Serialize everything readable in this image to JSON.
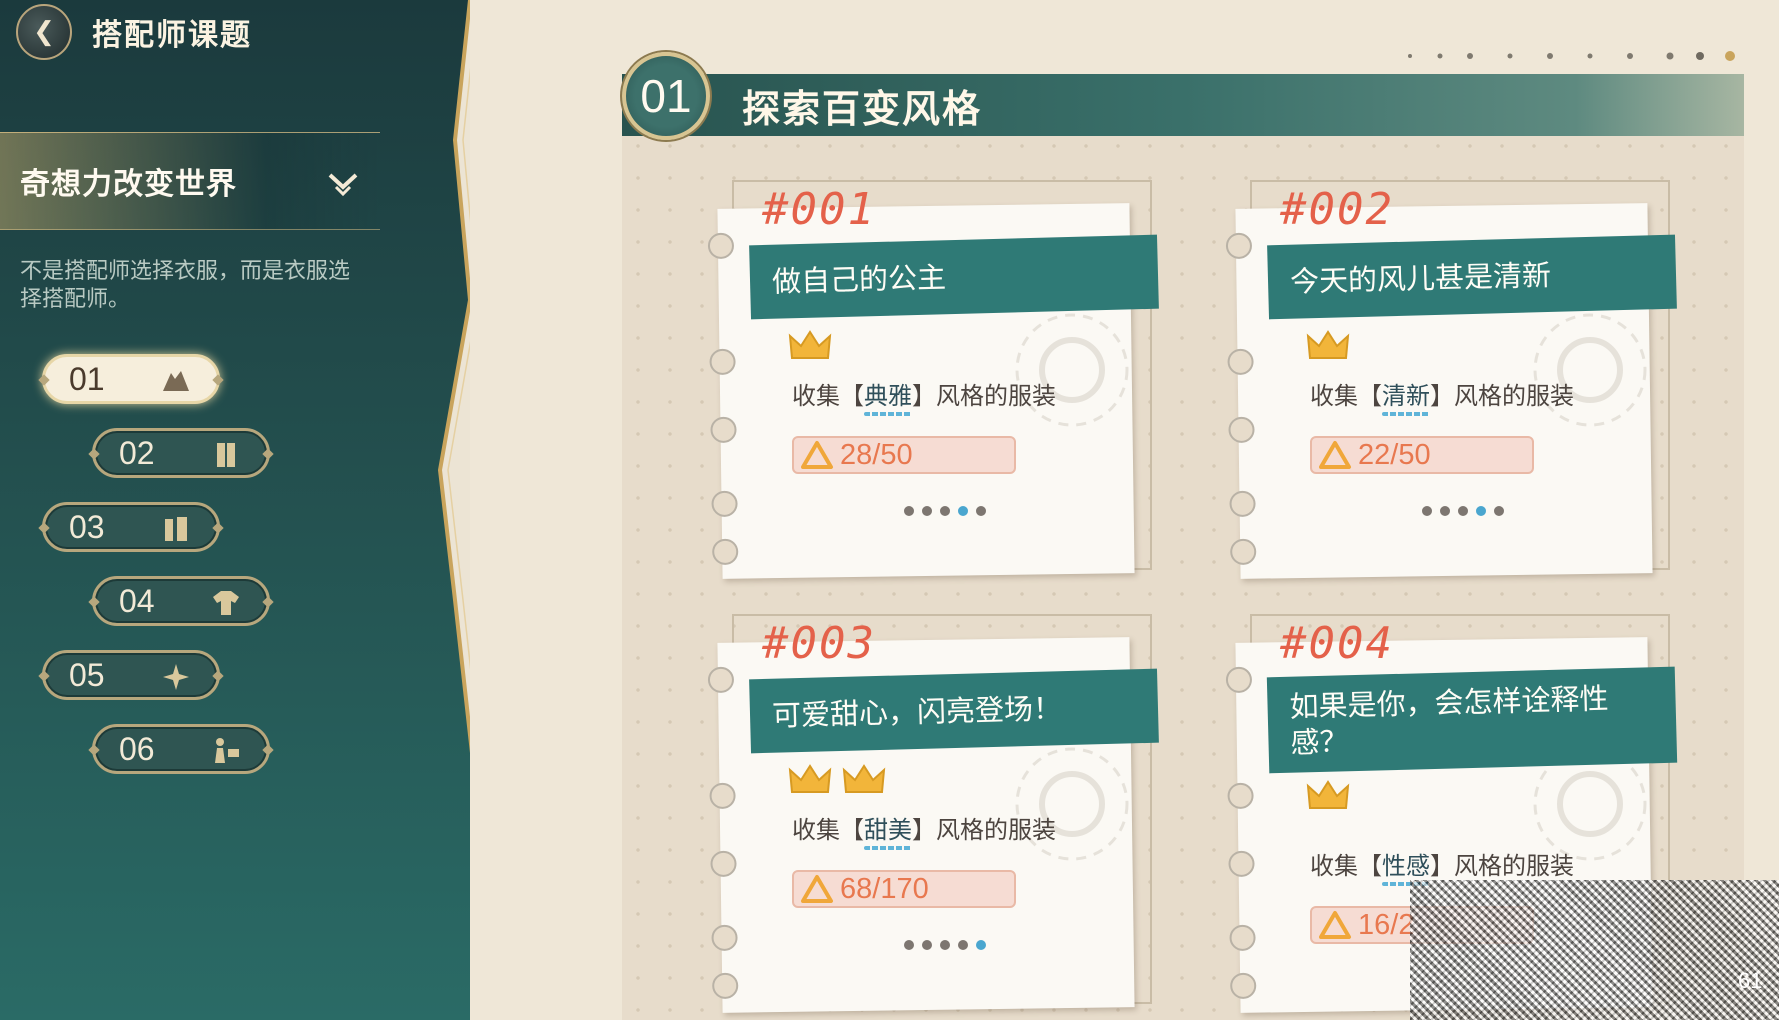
{
  "header": {
    "back_glyph": "❮",
    "title": "搭配师课题"
  },
  "topic": {
    "label": "奇想力改变世界",
    "description": "不是搭配师选择衣服，而是衣服选择搭配师。"
  },
  "chapters": [
    {
      "num": "01",
      "active": true
    },
    {
      "num": "02",
      "active": false
    },
    {
      "num": "03",
      "active": false
    },
    {
      "num": "04",
      "active": false
    },
    {
      "num": "05",
      "active": false
    },
    {
      "num": "06",
      "active": false
    }
  ],
  "section": {
    "number": "01",
    "title": "探索百变风格"
  },
  "cards": [
    {
      "number": "#001",
      "title": "做自己的公主",
      "crowns": 1,
      "desc_pre": "收集【",
      "keyword": "典雅",
      "desc_post": "】风格的服装",
      "progress": "28/50",
      "page_active": 4
    },
    {
      "number": "#002",
      "title": "今天的风儿甚是清新",
      "crowns": 1,
      "desc_pre": "收集【",
      "keyword": "清新",
      "desc_post": "】风格的服装",
      "progress": "22/50",
      "page_active": 4
    },
    {
      "number": "#003",
      "title": "可爱甜心，闪亮登场！",
      "crowns": 2,
      "desc_pre": "收集【",
      "keyword": "甜美",
      "desc_post": "】风格的服装",
      "progress": "68/170",
      "page_active": 5
    },
    {
      "number": "#004",
      "title": "如果是你，会怎样诠释性感？",
      "crowns": 1,
      "desc_pre": "收集【",
      "keyword": "性感",
      "desc_post": "】风格的服装",
      "progress": "16/2",
      "page_active": 0
    }
  ],
  "page_counter": "61",
  "colors": {
    "sidebar": "#234f4e",
    "accent_teal": "#2f7a76",
    "card_number": "#e4614a",
    "progress_text": "#e8784f",
    "crown": "#f2b53a",
    "gold_trim": "#b7a77d"
  },
  "icons": [
    "back-arrow-icon",
    "chevron-down-icon",
    "crown-icon",
    "warning-triangle-icon",
    "hanger-icon",
    "wardrobe-icon",
    "fitting-room-icon",
    "shirt-icon",
    "sparkle-icon",
    "dresser-person-icon"
  ]
}
